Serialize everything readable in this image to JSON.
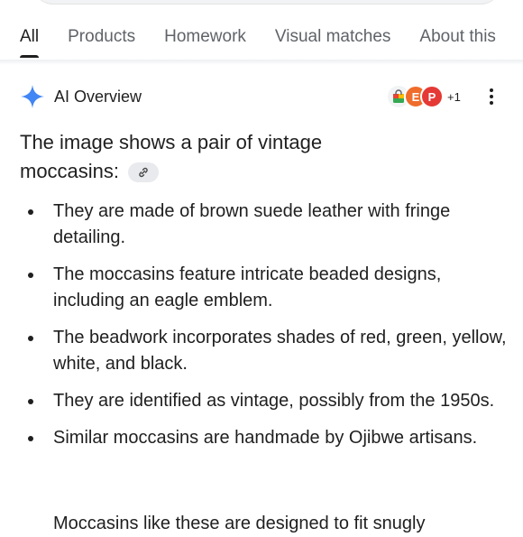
{
  "tabs": [
    {
      "label": "All",
      "active": true
    },
    {
      "label": "Products",
      "active": false
    },
    {
      "label": "Homework",
      "active": false
    },
    {
      "label": "Visual matches",
      "active": false
    },
    {
      "label": "About this",
      "active": false
    }
  ],
  "ai_overview": {
    "title": "AI Overview",
    "sources_icons": [
      "shopping-bag-icon",
      "etsy-icon",
      "pinterest-icon"
    ],
    "source_letters": [
      "",
      "E",
      "P"
    ],
    "sources_more": "+1",
    "intro_text": "The image shows a pair of vintage moccasins:",
    "bullets": [
      "They are made of brown suede leather with fringe detailing.",
      "The moccasins feature intricate beaded designs, including an eagle emblem.",
      "The beadwork incorporates shades of red, green, yellow, white, and black.",
      "They are identified as vintage, possibly from the 1950s.",
      "Similar moccasins are handmade by Ojibwe artisans."
    ],
    "truncated_line": "Moccasins like these are designed to fit snugly"
  },
  "colors": {
    "text": "#1f1f1f",
    "muted": "#5f6368",
    "sparkle": "#4285f4",
    "chip": "#e8eaed"
  }
}
